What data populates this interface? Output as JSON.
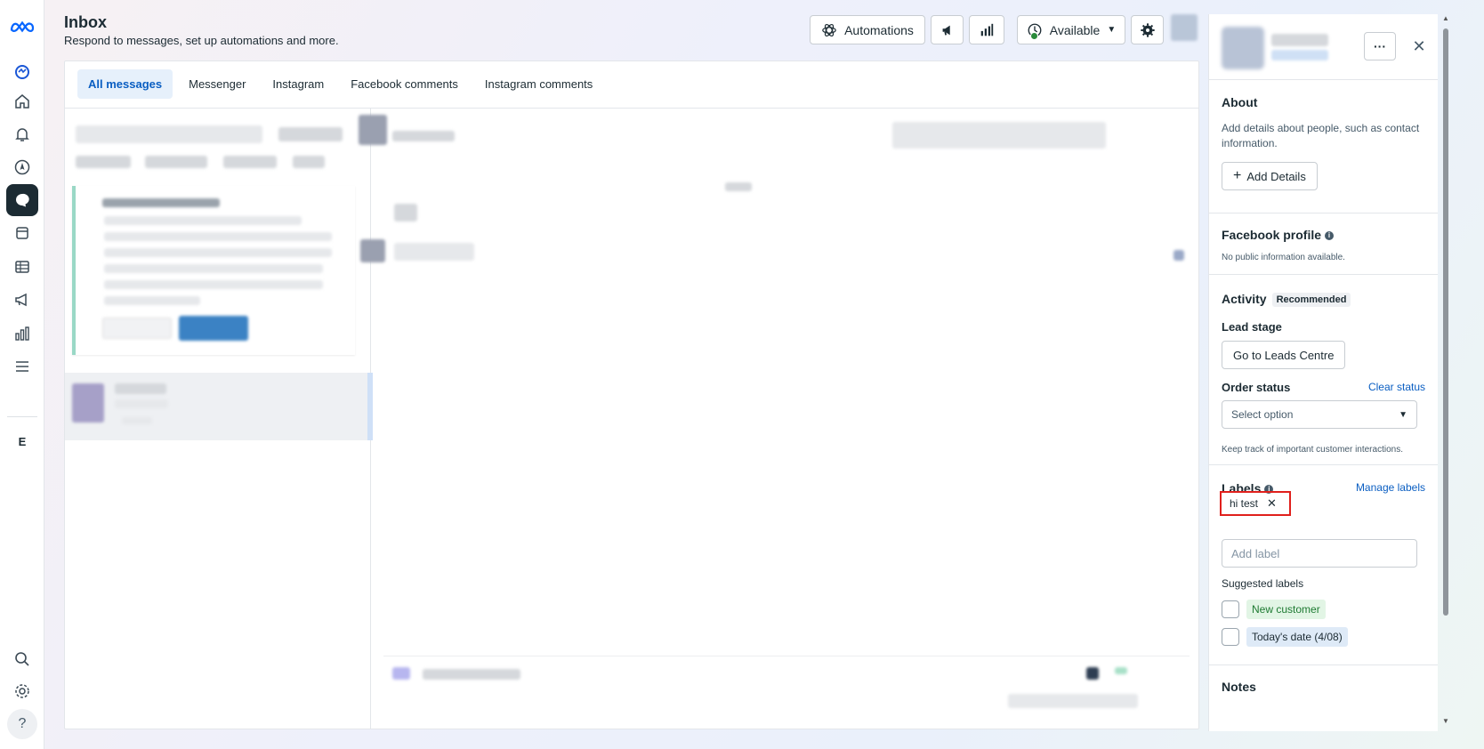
{
  "header": {
    "title": "Inbox",
    "subtitle": "Respond to messages, set up automations and more.",
    "automations_label": "Automations",
    "status_label": "Available"
  },
  "nav": {
    "letter": "E",
    "help": "?"
  },
  "tabs": [
    {
      "label": "All messages"
    },
    {
      "label": "Messenger"
    },
    {
      "label": "Instagram"
    },
    {
      "label": "Facebook comments"
    },
    {
      "label": "Instagram comments"
    }
  ],
  "right_panel": {
    "more": "···",
    "close": "✕",
    "about": {
      "title": "About",
      "description": "Add details about people, such as contact information.",
      "add_details_label": "Add Details"
    },
    "facebook_profile": {
      "title": "Facebook profile",
      "info": "No public information available."
    },
    "activity": {
      "title": "Activity",
      "badge": "Recommended",
      "lead_stage_title": "Lead stage",
      "leads_button": "Go to Leads Centre",
      "order_status_title": "Order status",
      "clear_status": "Clear status",
      "select_placeholder": "Select option",
      "note": "Keep track of important customer interactions."
    },
    "labels": {
      "title": "Labels",
      "manage": "Manage labels",
      "applied": [
        {
          "name": "hi test"
        }
      ],
      "add_placeholder": "Add label",
      "suggested_title": "Suggested labels",
      "suggested": [
        {
          "name": "New customer",
          "color": "#e2f5e5"
        },
        {
          "name": "Today's date (4/08)",
          "color": "#deeaf7"
        }
      ]
    },
    "notes": {
      "title": "Notes"
    }
  },
  "colors": {
    "accent": "#0a5ec2",
    "highlight_box": "#e0201c",
    "active_nav": "#1c2b33"
  }
}
